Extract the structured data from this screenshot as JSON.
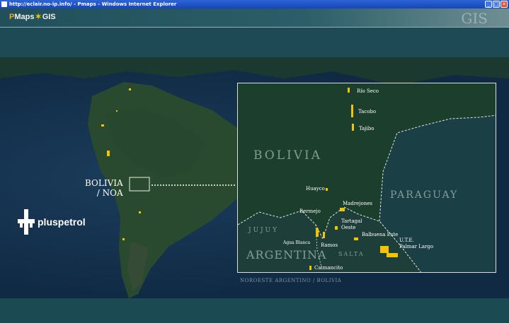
{
  "window": {
    "title": "http://eclair.no-ip.info/ - Pmaps - Windows Internet Explorer",
    "buttons": {
      "minimize": "_",
      "maximize": "□",
      "close": "✕"
    }
  },
  "header": {
    "logo_p": "P",
    "logo_maps": "Maps",
    "logo_gis": "GIS",
    "deco_text": "GIS"
  },
  "map": {
    "brand": "pluspetrol",
    "callout_line1": "BOLIVIA",
    "callout_line2": "/ NOA",
    "caption": "NOROESTE ARGENTINO / BOLIVIA"
  },
  "inset": {
    "countries": {
      "bolivia": "BOLIVIA",
      "paraguay": "PARAGUAY",
      "argentina": "ARGENTINA",
      "jujuy": "JUJUY",
      "salta": "SALTA"
    },
    "fields": [
      {
        "name": "Río Seco"
      },
      {
        "name": "Tacobo"
      },
      {
        "name": "Tajibo"
      },
      {
        "name": "Huayco"
      },
      {
        "name": "Madrejones"
      },
      {
        "name": "Bermejo"
      },
      {
        "name": "Tartagal"
      },
      {
        "name": "Oeste"
      },
      {
        "name": "Balbuena Este"
      },
      {
        "name": "U.T.E."
      },
      {
        "name": "Palmar Largo"
      },
      {
        "name": "Agua Blanca"
      },
      {
        "name": "Ramos"
      },
      {
        "name": "Caimancito"
      }
    ]
  },
  "colors": {
    "field": "#f5c400",
    "header": "#2b5e68",
    "ocean": "#102a44"
  }
}
